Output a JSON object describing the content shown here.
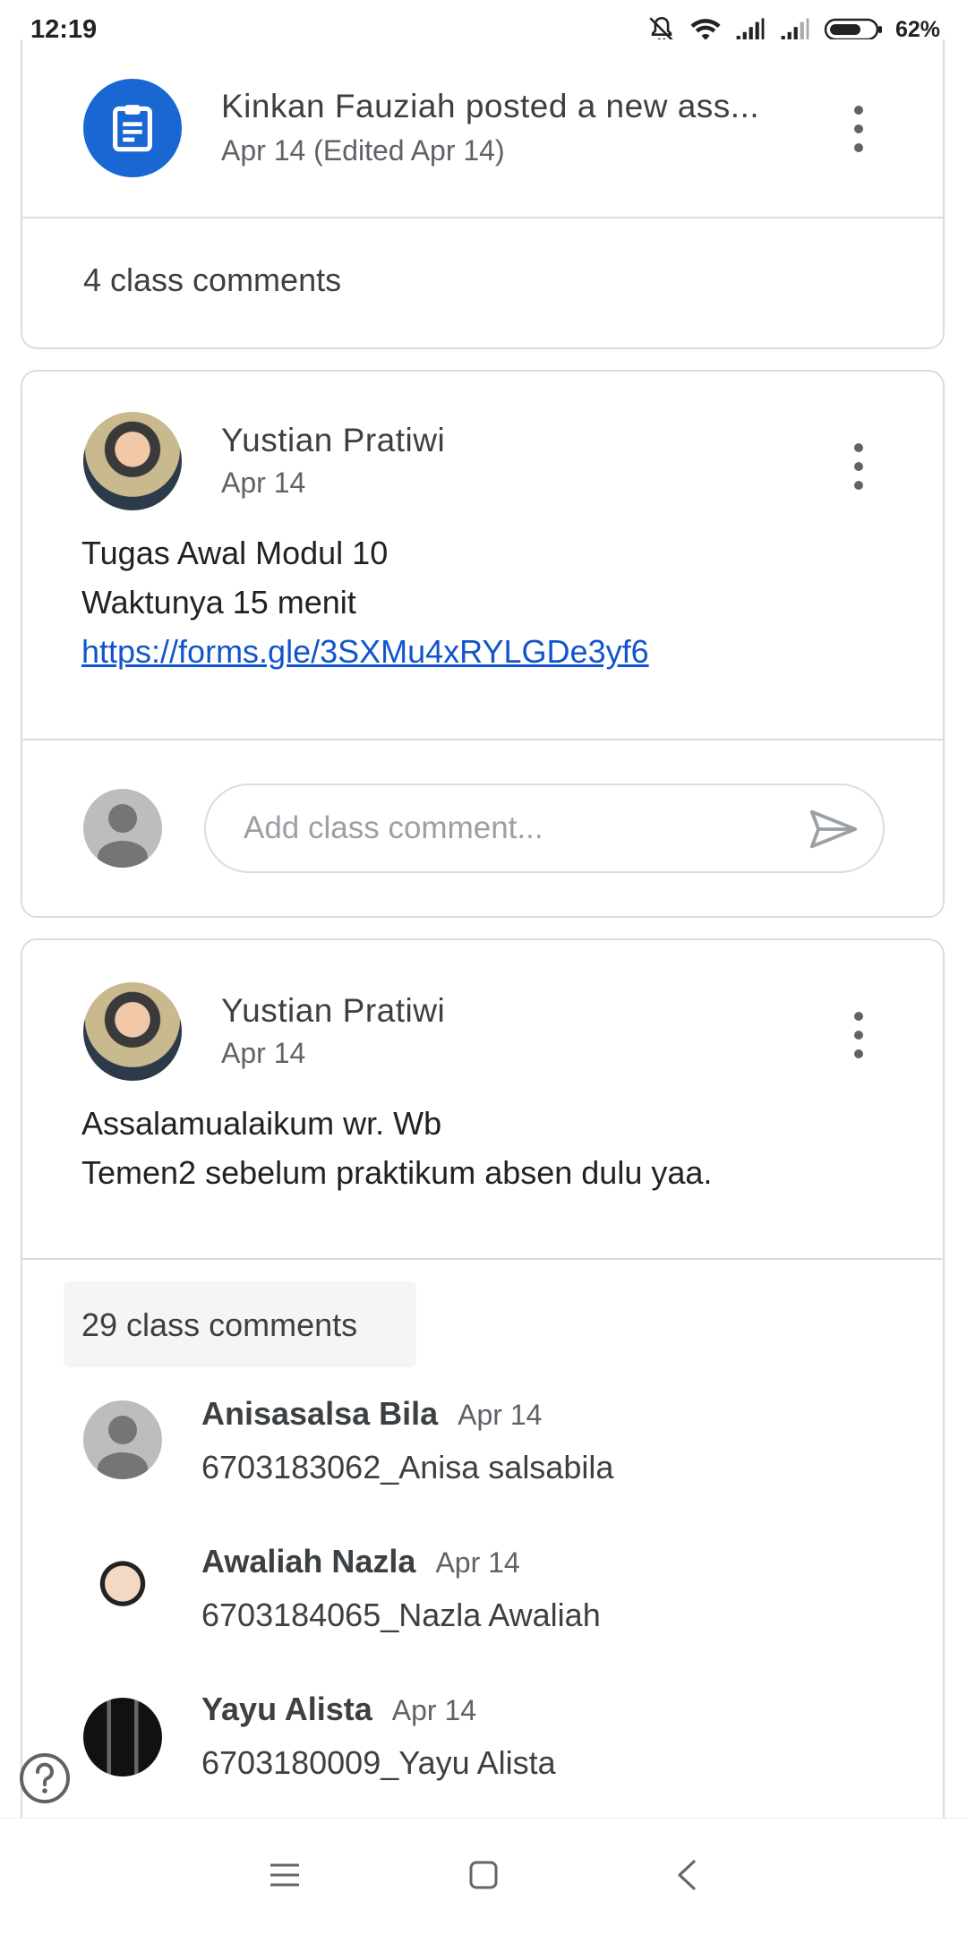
{
  "status_bar": {
    "time": "12:19",
    "battery": "62%"
  },
  "post1": {
    "title": "Kinkan Fauziah posted a new ass...",
    "date": "Apr 14 (Edited Apr 14)",
    "comments_count": "4 class comments"
  },
  "post2": {
    "author": "Yustian Pratiwi",
    "date": "Apr 14",
    "lines": [
      "Tugas Awal Modul 10",
      "Waktunya 15 menit"
    ],
    "link": "https://forms.gle/3SXMu4xRYLGDe3yf6",
    "comment_placeholder": "Add class comment..."
  },
  "post3": {
    "author": "Yustian Pratiwi",
    "date": "Apr 14",
    "lines": [
      "Assalamualaikum wr. Wb",
      "Temen2 sebelum praktikum absen dulu yaa."
    ],
    "comments_count": "29 class comments",
    "comments": [
      {
        "name": "Anisasalsa Bila",
        "date": "Apr 14",
        "text": "6703183062_Anisa salsabila"
      },
      {
        "name": "Awaliah Nazla",
        "date": "Apr 14",
        "text": "6703184065_Nazla Awaliah"
      },
      {
        "name": "Yayu Alista",
        "date": "Apr 14",
        "text": "6703180009_Yayu Alista"
      }
    ]
  },
  "colors": {
    "accent": "#1967d2",
    "border": "#dadce0",
    "link": "#1155cc"
  }
}
